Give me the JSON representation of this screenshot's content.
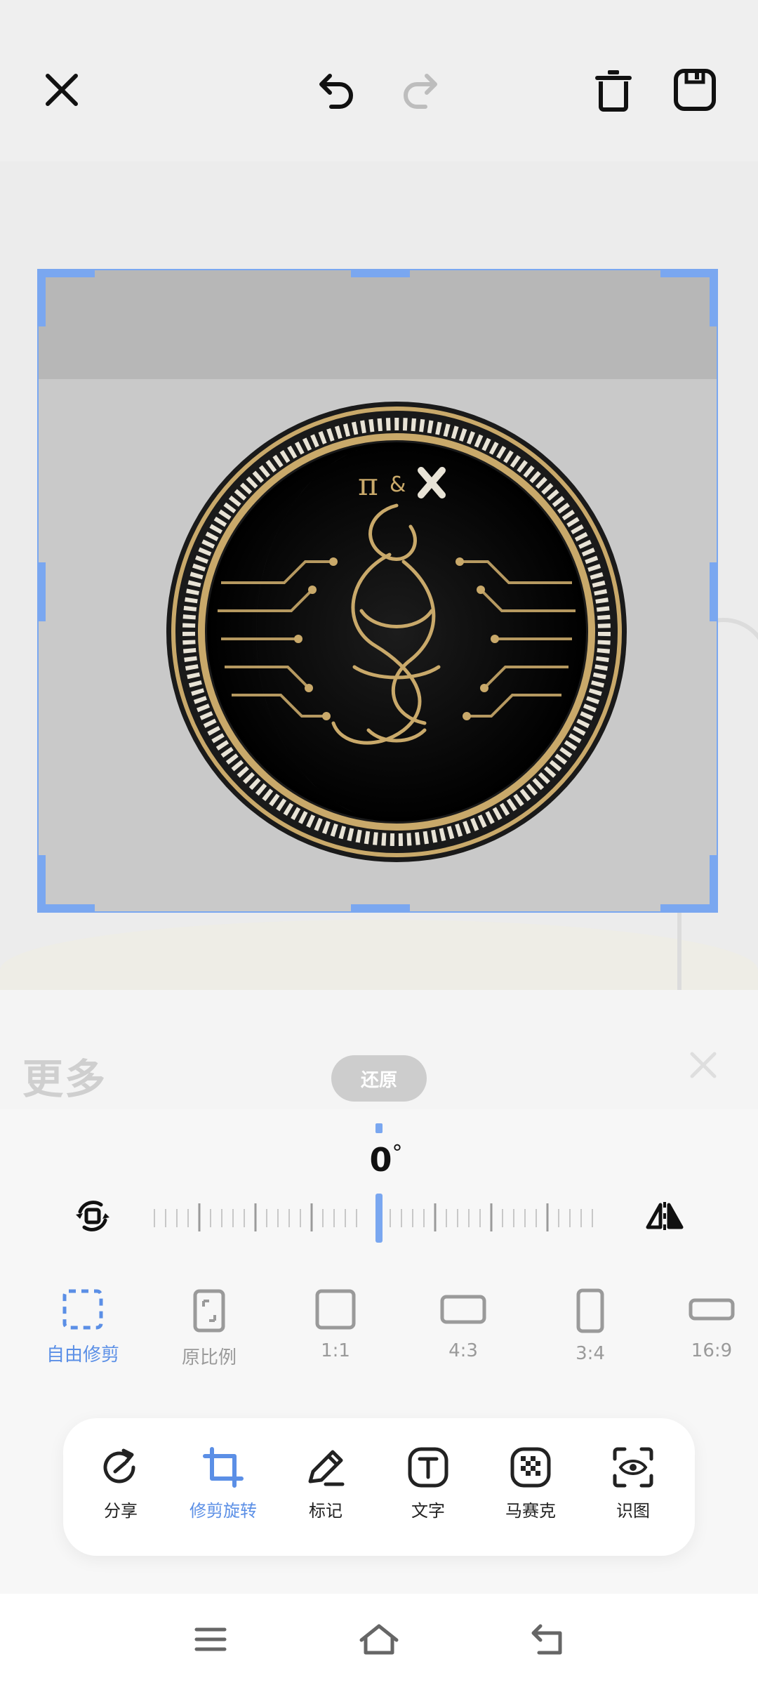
{
  "top_bar": {
    "close_icon": "close-icon",
    "undo_icon": "undo-icon",
    "redo_icon": "redo-icon",
    "delete_icon": "trash-icon",
    "save_icon": "save-icon"
  },
  "panel": {
    "title": "更多",
    "reset_label": "还原",
    "angle_value": "0",
    "angle_unit": "°"
  },
  "ratios": [
    {
      "label": "自由修剪",
      "active": true
    },
    {
      "label": "原比例",
      "active": false
    },
    {
      "label": "1:1",
      "active": false
    },
    {
      "label": "4:3",
      "active": false
    },
    {
      "label": "3:4",
      "active": false
    },
    {
      "label": "16:9",
      "active": false
    }
  ],
  "tools": [
    {
      "label": "分享",
      "active": false
    },
    {
      "label": "修剪旋转",
      "active": true
    },
    {
      "label": "标记",
      "active": false
    },
    {
      "label": "文字",
      "active": false
    },
    {
      "label": "马赛克",
      "active": false
    },
    {
      "label": "识图",
      "active": false
    }
  ],
  "colors": {
    "accent": "#5b8fe6",
    "crop_border": "#7aa7f0",
    "coin_gold": "#c9a96a"
  }
}
